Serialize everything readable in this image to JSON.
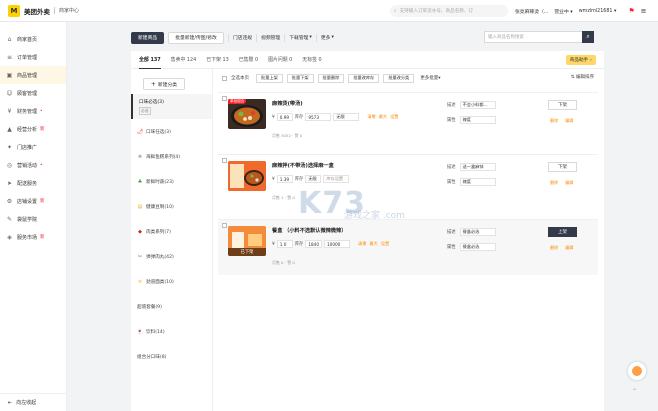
{
  "header": {
    "logo_mark": "M",
    "app_title": "美团外卖",
    "app_sub": "商家中心",
    "search_placeholder": "支持输入订单流水号、商品名称、订",
    "store_name": "张亮麻辣烫（...",
    "status": "营业中",
    "account": "wmzlml21681"
  },
  "sidebar": {
    "items": [
      {
        "label": "商家首页",
        "icon": "home-icon",
        "glyph": "⌂"
      },
      {
        "label": "订单管理",
        "icon": "order-icon",
        "glyph": "≡"
      },
      {
        "label": "商品管理",
        "icon": "goods-icon",
        "glyph": "▣"
      },
      {
        "label": "顾客管理",
        "icon": "customer-icon",
        "glyph": "☺"
      },
      {
        "label": "财务管理",
        "icon": "finance-icon",
        "glyph": "¥"
      },
      {
        "label": "经营分析",
        "icon": "analysis-icon",
        "glyph": "▲"
      },
      {
        "label": "门店推广",
        "icon": "promo-icon",
        "glyph": "✦"
      },
      {
        "label": "营销活动",
        "icon": "marketing-icon",
        "glyph": "◎"
      },
      {
        "label": "配送服务",
        "icon": "delivery-icon",
        "glyph": "➤"
      },
      {
        "label": "店铺设置",
        "icon": "store-settings-icon",
        "glyph": "⚙"
      },
      {
        "label": "袋鼠学院",
        "icon": "academy-icon",
        "glyph": "✎"
      },
      {
        "label": "服务市场",
        "icon": "market-icon",
        "glyph": "◈"
      }
    ],
    "badges": {
      "finance": "•",
      "analysis": "新",
      "marketing": "•",
      "store_settings": "新",
      "market": "新"
    },
    "collapse_label": "向左收起"
  },
  "toolbar": {
    "new_goods": "新建商品",
    "batch_new": "批量新建/传图/修改",
    "store_violation": "门店违规",
    "video_mgmt": "视频管理",
    "download_mgmt": "下载管理",
    "more": "更多",
    "search_placeholder": "输入商品名称搜索"
  },
  "tabs": [
    {
      "label": "全部 137"
    },
    {
      "label": "售卖中 124"
    },
    {
      "label": "已下架 13"
    },
    {
      "label": "已售罄 0"
    },
    {
      "label": "图片问题 0"
    },
    {
      "label": "无标签 0"
    }
  ],
  "helper_label": "商品助手",
  "categories": {
    "new_label": "新建分类",
    "tag_required": "必选",
    "items": [
      {
        "label": "口味必选(3)",
        "glyph": ""
      },
      {
        "label": "口味任选(3)",
        "glyph": "🌶"
      },
      {
        "label": "海鲜鱼糕系列(4)",
        "glyph": "❋"
      },
      {
        "label": "新鲜时蔬(23)",
        "glyph": "♣"
      },
      {
        "label": "健康豆制(10)",
        "glyph": "▤"
      },
      {
        "label": "肉类系列(7)",
        "glyph": "◆"
      },
      {
        "label": "弹弹肉丸(42)",
        "glyph": "✂"
      },
      {
        "label": "劲道面类(10)",
        "glyph": "≋"
      },
      {
        "label": "超值套餐(9)",
        "glyph": ""
      },
      {
        "label": "饮料(14)",
        "glyph": "🍷"
      },
      {
        "label": "组合分口味(8)",
        "glyph": ""
      }
    ]
  },
  "batch": {
    "select_all": "全选本页",
    "on_shelf": "批量上架",
    "off_shelf": "批量下架",
    "delete": "批量删除",
    "edit_stock": "批量改库存",
    "edit_category": "批量改分类",
    "more": "更多批量",
    "sort": "编辑排序"
  },
  "products": [
    {
      "name": "麻辣烫(带汤)",
      "hot_tag": "单品组合",
      "currency": "¥",
      "price": "0.99",
      "stock_label": "库存",
      "stock": "9573",
      "limit": "无限",
      "link_stock": "清零",
      "link_max": "最大",
      "link_set": "设置",
      "meta": "月售 3052 · 赞 0",
      "attr1_label": "描述",
      "attr1_value": "不会小料都...",
      "attr2_label": "属性",
      "attr2_value": "辣度",
      "op": "下架",
      "link_delete": "删除",
      "link_edit": "编辑"
    },
    {
      "name": "麻辣拌(不带汤)选择麻一盒",
      "hot_tag": "",
      "currency": "¥",
      "price": "1.39",
      "stock_label": "库存",
      "stock": "无限",
      "limit": "库存设置",
      "link_stock": "清零",
      "link_max": "最大",
      "link_set": "设置",
      "meta": "月售 1 · 赞 0",
      "attr1_label": "描述",
      "attr1_value": "送一盒麻钵",
      "attr2_label": "属性",
      "attr2_value": "辣度",
      "op": "下架",
      "link_delete": "删除",
      "link_edit": "编辑"
    },
    {
      "name": "餐盒 （小料不选默认微辣微辣）",
      "hot_tag": "",
      "out_tag": "已下架",
      "currency": "¥",
      "price": "1.0",
      "stock_label": "库存",
      "stock": "1840",
      "limit": "10000",
      "link_stock": "清零",
      "link_max": "最大",
      "link_set": "设置",
      "meta": "月售 0 · 赞 0",
      "attr1_label": "描述",
      "attr1_value": "餐盒必选",
      "attr2_label": "属性",
      "attr2_value": "餐盒必选",
      "op": "上架",
      "link_delete": "删除",
      "link_edit": "编辑"
    }
  ],
  "watermark": {
    "text": "K73",
    "sub": "游戏之家 .com"
  }
}
